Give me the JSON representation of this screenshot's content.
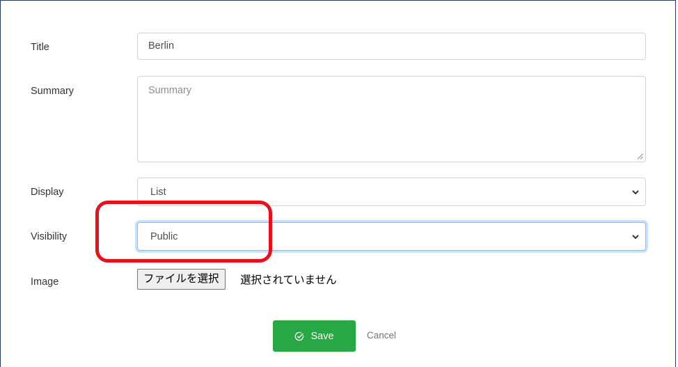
{
  "form": {
    "title": {
      "label": "Title",
      "value": "Berlin"
    },
    "summary": {
      "label": "Summary",
      "placeholder": "Summary"
    },
    "display": {
      "label": "Display",
      "selected": "List"
    },
    "visibility": {
      "label": "Visibility",
      "selected": "Public"
    },
    "image": {
      "label": "Image",
      "button_label": "ファイルを選択",
      "status": "選択されていません"
    }
  },
  "actions": {
    "save_label": "Save",
    "save_icon": "check-circle-icon",
    "cancel_label": "Cancel"
  },
  "colors": {
    "save_bg": "#28a745",
    "highlight": "#e8101a",
    "focus_border": "#80bdff"
  }
}
